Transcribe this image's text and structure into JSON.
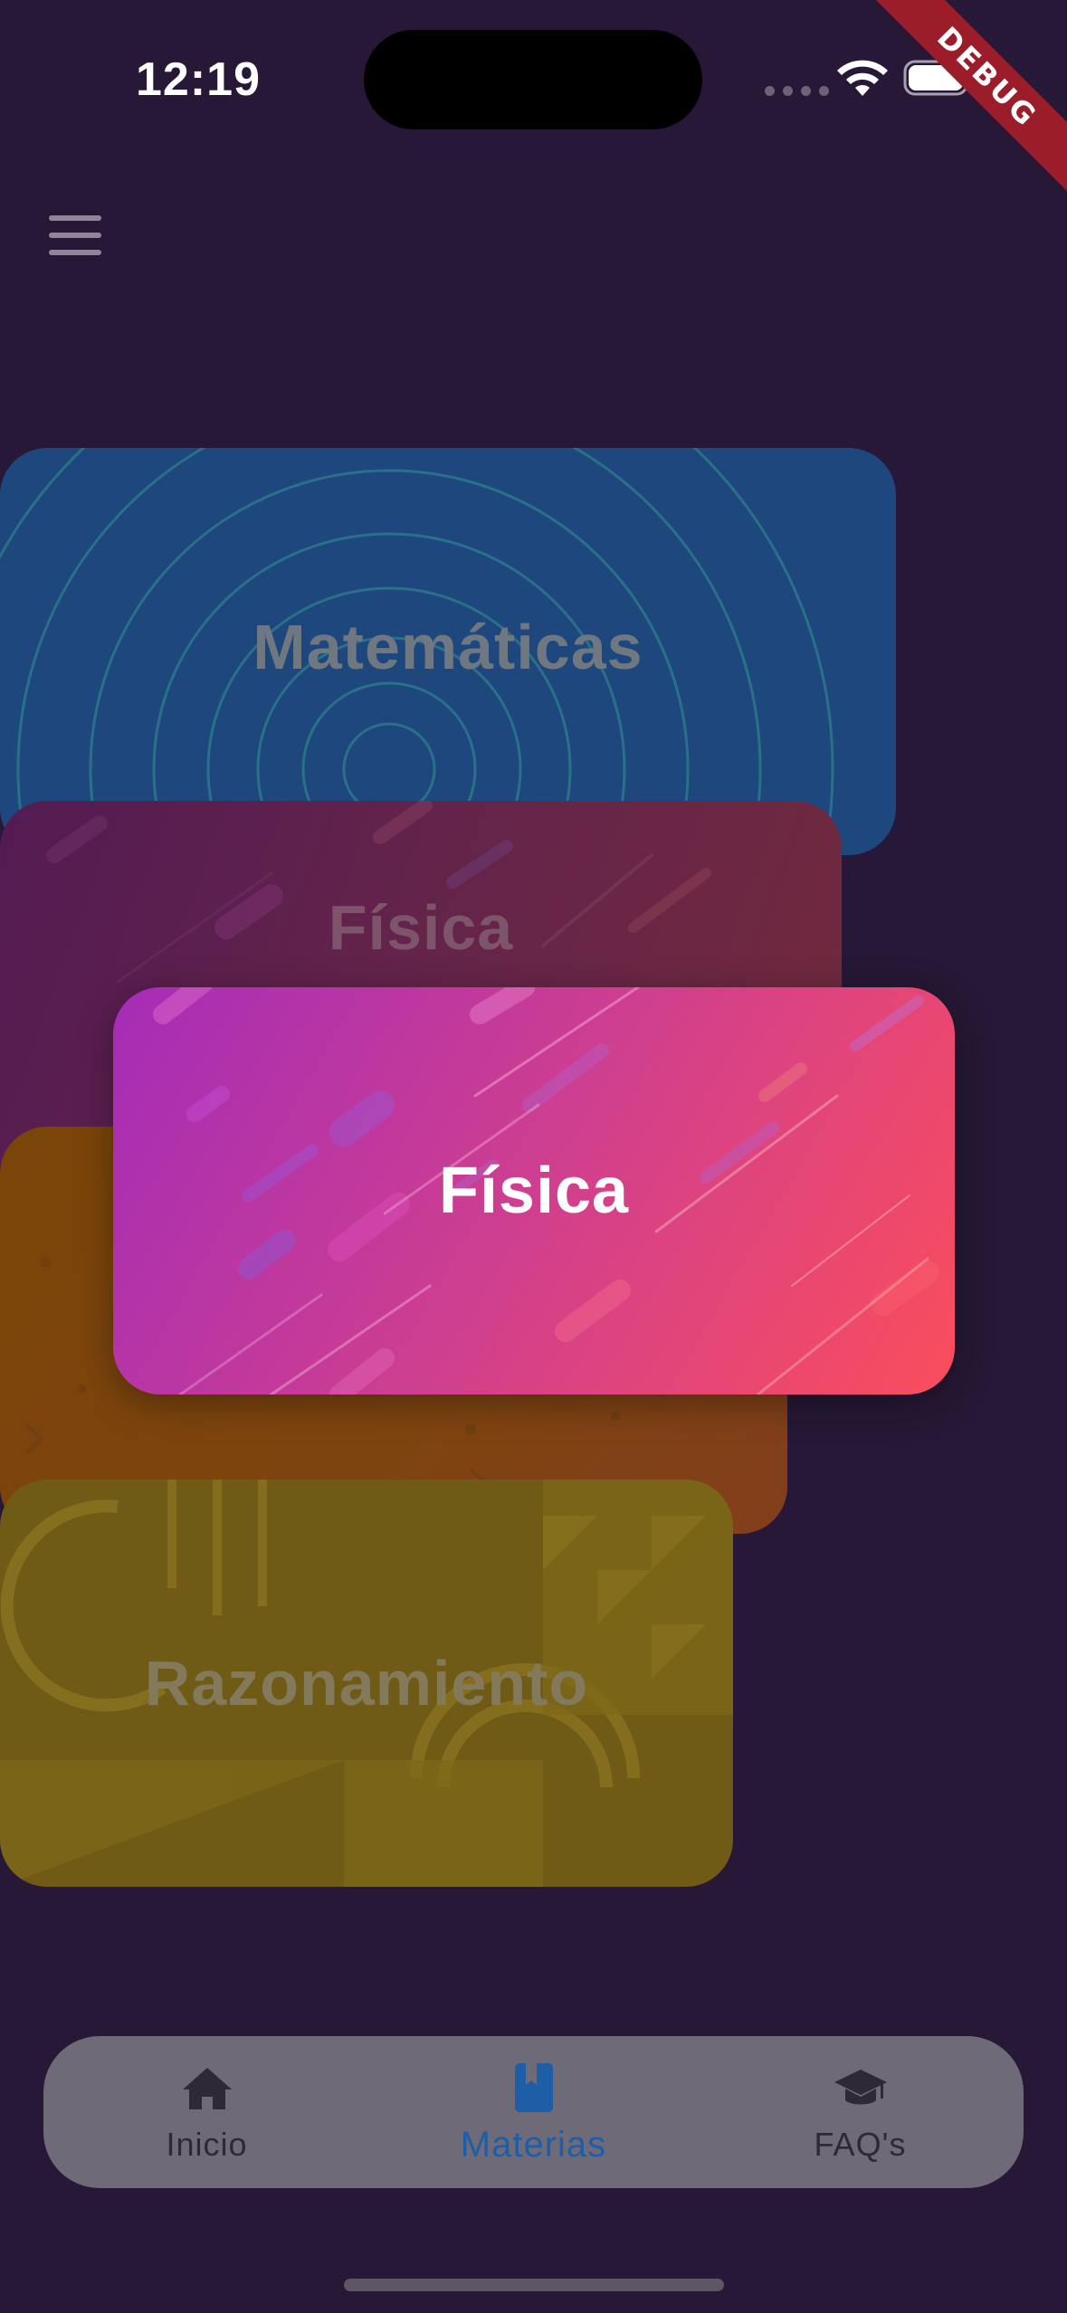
{
  "status_bar": {
    "time": "12:19",
    "debug_banner": "DEBUG"
  },
  "cards": {
    "matematicas": "Matemáticas",
    "fisica_back": "Física",
    "fisica_front": "Física",
    "razonamiento": "Razonamiento"
  },
  "nav": {
    "items": [
      {
        "label": "Inicio",
        "icon": "home-icon"
      },
      {
        "label": "Materias",
        "icon": "book-icon",
        "active": true
      },
      {
        "label": "FAQ's",
        "icon": "graduation-cap-icon"
      }
    ]
  },
  "colors": {
    "background": "#261836",
    "active_nav": "#1d5ea6",
    "nav_bar": "#6f6a77",
    "fisica_gradient_start": "#a42cb7",
    "fisica_gradient_end": "#fb4d5c"
  }
}
